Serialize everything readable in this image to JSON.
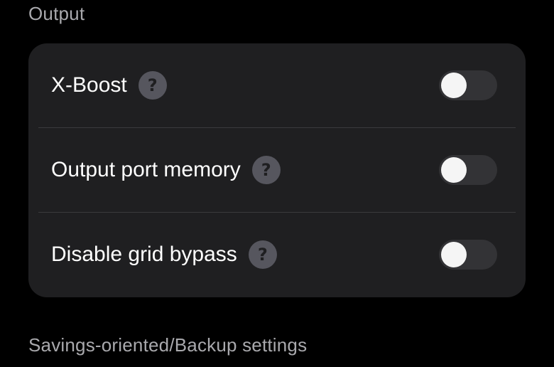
{
  "sections": {
    "output_title": "Output",
    "savings_title": "Savings-oriented/Backup settings"
  },
  "rows": [
    {
      "label": "X-Boost",
      "help_icon": "question-mark-icon",
      "help_glyph": "?",
      "enabled": false
    },
    {
      "label": "Output port memory",
      "help_icon": "question-mark-icon",
      "help_glyph": "?",
      "enabled": false
    },
    {
      "label": "Disable grid bypass",
      "help_icon": "question-mark-icon",
      "help_glyph": "?",
      "enabled": false
    }
  ],
  "colors": {
    "background": "#000000",
    "card": "#1f1f21",
    "section_title": "#a9a9ad",
    "toggle_track_off": "#333336",
    "toggle_knob": "#f5f5f5",
    "help_icon_bg": "#56565e"
  }
}
